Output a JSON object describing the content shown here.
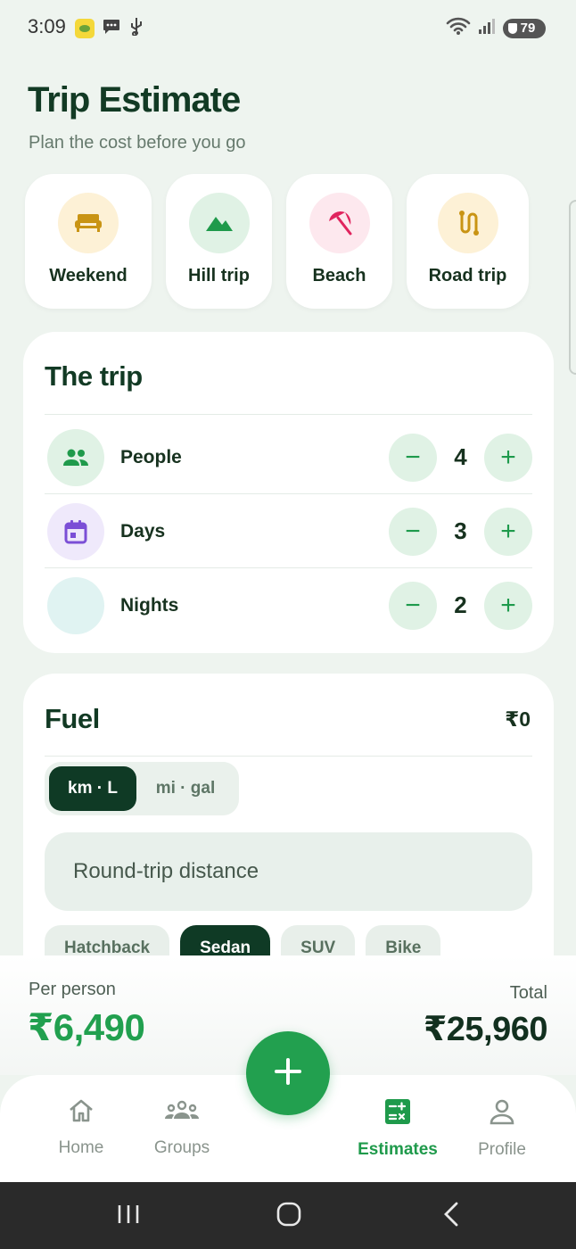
{
  "status_bar": {
    "time": "3:09",
    "battery": "79",
    "icons": [
      "lemon-app-icon",
      "chat-icon",
      "usb-icon",
      "wifi-icon",
      "signal-icon",
      "battery-icon"
    ]
  },
  "header": {
    "title": "Trip Estimate",
    "subtitle": "Plan the cost before you go"
  },
  "presets": [
    {
      "label": "Weekend",
      "icon": "sofa-icon",
      "bg": "#fdf1d6",
      "color": "#c99414"
    },
    {
      "label": "Hill trip",
      "icon": "mountain-icon",
      "bg": "#e0f2e5",
      "color": "#1f9a4b"
    },
    {
      "label": "Beach",
      "icon": "umbrella-icon",
      "bg": "#fde8ee",
      "color": "#e0245e"
    },
    {
      "label": "Road trip",
      "icon": "route-icon",
      "bg": "#fdf1d6",
      "color": "#c99414"
    }
  ],
  "trip": {
    "title": "The trip",
    "rows": [
      {
        "label": "People",
        "value": "4",
        "icon": "people-icon",
        "bg": "#e0f2e5",
        "color": "#1f9a4b"
      },
      {
        "label": "Days",
        "value": "3",
        "icon": "calendar-icon",
        "bg": "#efe9fb",
        "color": "#7b4fd6"
      },
      {
        "label": "Nights",
        "value": "2",
        "icon": "moon-icon",
        "bg": "#e0f3f2",
        "color": "#178a87"
      }
    ],
    "minus": "−",
    "plus": "+"
  },
  "fuel": {
    "title": "Fuel",
    "total": "₹0",
    "units": {
      "active": "km · L",
      "inactive": "mi · gal"
    },
    "distance_placeholder": "Round-trip distance",
    "vehicles": [
      {
        "label": "Hatchback",
        "active": false
      },
      {
        "label": "Sedan",
        "active": true
      },
      {
        "label": "SUV",
        "active": false
      },
      {
        "label": "Bike",
        "active": false
      }
    ]
  },
  "summary": {
    "per_person_label": "Per person",
    "per_person_value": "₹6,490",
    "total_label": "Total",
    "total_value": "₹25,960"
  },
  "nav": {
    "items": [
      {
        "label": "Home",
        "icon": "home-icon",
        "active": false
      },
      {
        "label": "Groups",
        "icon": "groups-icon",
        "active": false
      },
      {
        "label": "Estimates",
        "icon": "calculator-icon",
        "active": true
      },
      {
        "label": "Profile",
        "icon": "profile-icon",
        "active": false
      }
    ],
    "fab_icon": "plus-icon"
  },
  "colors": {
    "accent": "#22a04f",
    "dark": "#0f3a25",
    "background": "#eef4ef"
  }
}
